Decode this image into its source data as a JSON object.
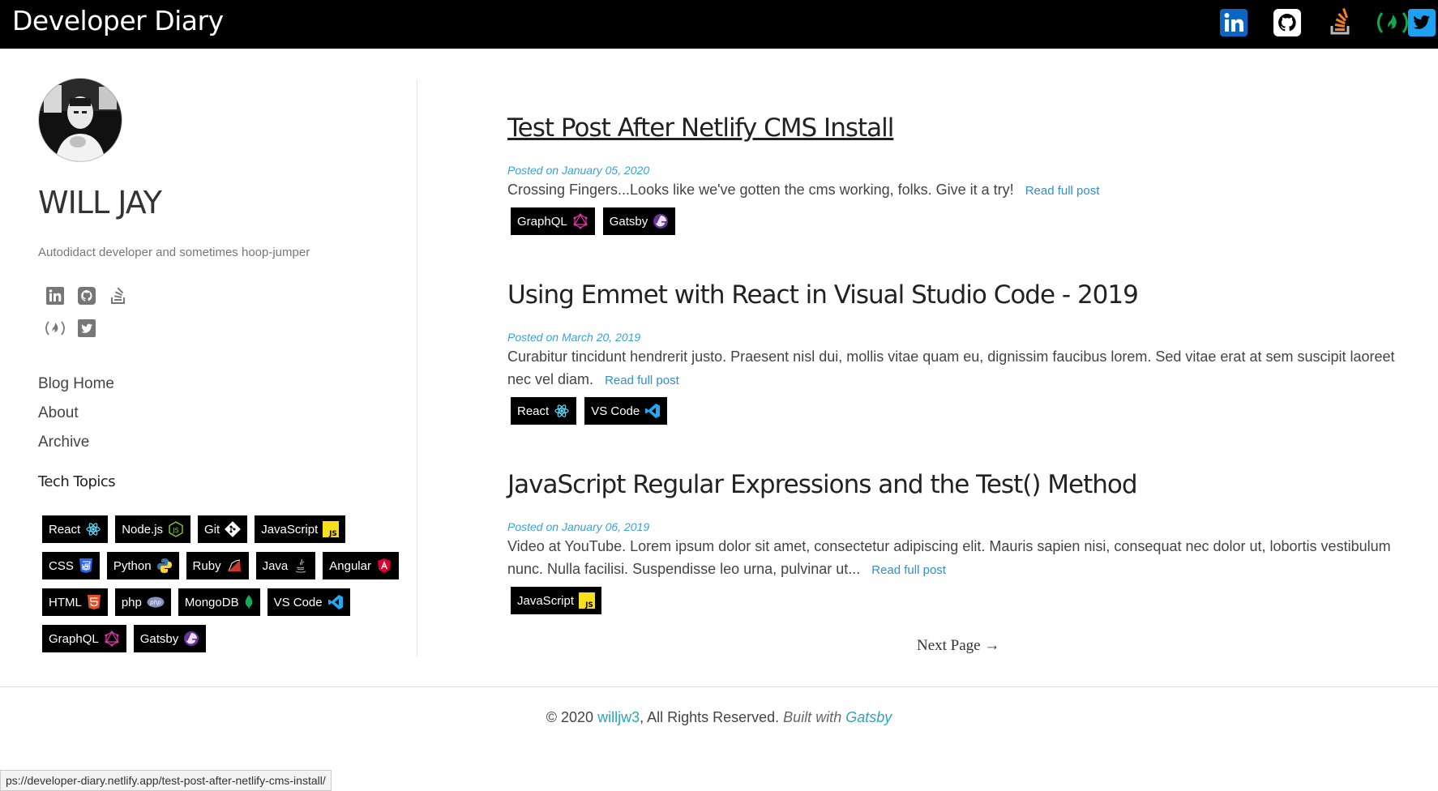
{
  "header": {
    "brand": "Developer Diary",
    "icons": [
      {
        "name": "linkedin",
        "color": "#0a66c2"
      },
      {
        "name": "github",
        "color": "#ffffff"
      },
      {
        "name": "stackoverflow",
        "color": "#f48024"
      },
      {
        "name": "freecodecamp",
        "color": "#10a950"
      },
      {
        "name": "twitter",
        "color": "#1da1f2"
      }
    ]
  },
  "sidebar": {
    "author": "WILL JAY",
    "tagline": "Autodidact developer and sometimes hoop-jumper",
    "social": [
      "linkedin-icon",
      "github-icon",
      "stackoverflow-icon",
      "freecodecamp-icon",
      "twitter-icon"
    ],
    "nav": [
      "Blog Home",
      "About",
      "Archive"
    ],
    "topics_title": "Tech Topics",
    "topics": [
      {
        "label": "React",
        "icon": "react"
      },
      {
        "label": "Node.js",
        "icon": "nodejs"
      },
      {
        "label": "Git",
        "icon": "git"
      },
      {
        "label": "JavaScript",
        "icon": "js"
      },
      {
        "label": "CSS",
        "icon": "css"
      },
      {
        "label": "Python",
        "icon": "python"
      },
      {
        "label": "Ruby",
        "icon": "ruby"
      },
      {
        "label": "Java",
        "icon": "java"
      },
      {
        "label": "Angular",
        "icon": "angular"
      },
      {
        "label": "HTML",
        "icon": "html"
      },
      {
        "label": "php",
        "icon": "php"
      },
      {
        "label": "MongoDB",
        "icon": "mongodb"
      },
      {
        "label": "VS Code",
        "icon": "vscode"
      },
      {
        "label": "GraphQL",
        "icon": "graphql"
      },
      {
        "label": "Gatsby",
        "icon": "gatsby"
      }
    ]
  },
  "posts": [
    {
      "title": "Test Post After Netlify CMS Install",
      "date": "Posted on January 05, 2020",
      "excerpt": "Crossing Fingers...Looks like we've gotten the cms working, folks. Give it a try!",
      "read_more": "Read full post",
      "tags": [
        {
          "label": "GraphQL",
          "icon": "graphql"
        },
        {
          "label": "Gatsby",
          "icon": "gatsby"
        }
      ]
    },
    {
      "title": "Using Emmet with React in Visual Studio Code - 2019",
      "date": "Posted on March 20, 2019",
      "excerpt": "Curabitur tincidunt hendrerit justo. Praesent nisl dui, mollis vitae quam eu, dignissim faucibus lorem. Sed vitae erat at sem suscipit laoreet nec vel diam.",
      "read_more": "Read full post",
      "tags": [
        {
          "label": "React",
          "icon": "react"
        },
        {
          "label": "VS Code",
          "icon": "vscode"
        }
      ]
    },
    {
      "title": "JavaScript Regular Expressions and the Test() Method",
      "date": "Posted on January 06, 2019",
      "excerpt": "Video at YouTube. Lorem ipsum dolor sit amet, consectetur adipiscing elit. Mauris sapien nisi, consequat nec dolor ut, lobortis vestibulum nunc. Nulla facilisi. Suspendisse leo urna, pulvinar ut...",
      "read_more": "Read full post",
      "tags": [
        {
          "label": "JavaScript",
          "icon": "js"
        }
      ]
    }
  ],
  "pagination": {
    "next": "Next Page →"
  },
  "footer": {
    "prefix": "© 2020 ",
    "owner": "willjw3",
    "rights": ", All Rights Reserved. ",
    "built_with": "Built with ",
    "gatsby": "Gatsby"
  },
  "statusbar": {
    "url": "ps://developer-diary.netlify.app/test-post-after-netlify-cms-install/"
  }
}
